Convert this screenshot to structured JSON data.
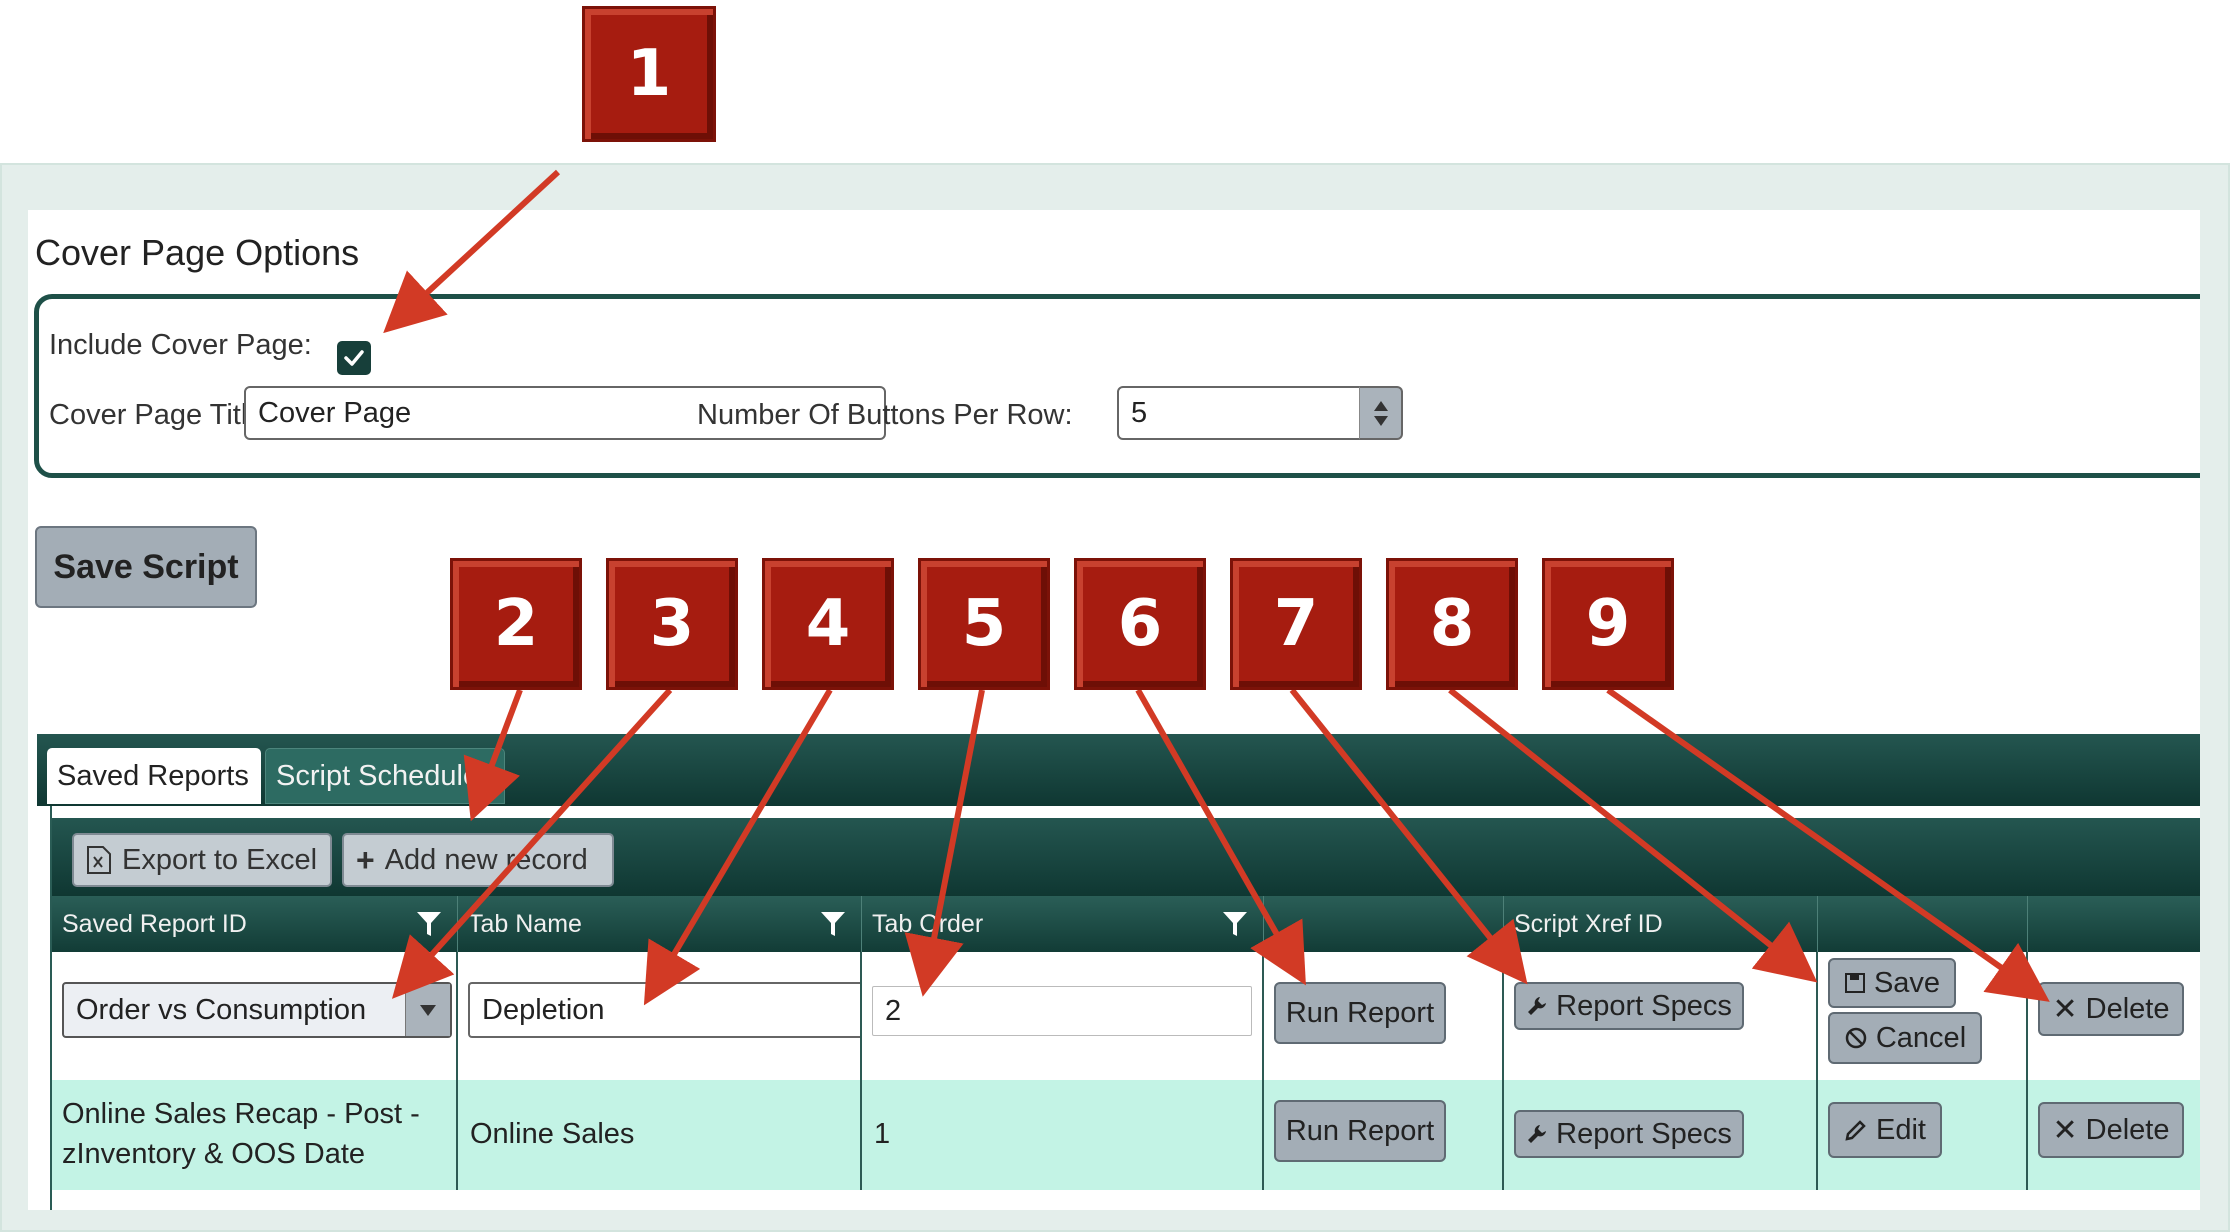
{
  "cover_page": {
    "title": "Cover Page Options",
    "include_label": "Include Cover Page:",
    "include_checked": true,
    "title_label": "Cover Page Title:",
    "title_value": "Cover Page",
    "buttons_per_row_label": "Number Of Buttons Per Row:",
    "buttons_per_row_value": "5"
  },
  "save_script_label": "Save Script",
  "tabs": [
    {
      "label": "Saved Reports",
      "active": true
    },
    {
      "label": "Script Schedule",
      "active": false
    }
  ],
  "toolbar": {
    "export_label": "Export to Excel",
    "add_label": "Add new record"
  },
  "columns": [
    "Saved Report ID",
    "Tab Name",
    "Tab Order",
    "",
    "Script Xref ID",
    "",
    ""
  ],
  "edit_row": {
    "report_id": "Order vs Consumption",
    "tab_name": "Depletion",
    "tab_order": "2",
    "run_label": "Run Report",
    "specs_label": "Report Specs",
    "save_label": "Save",
    "cancel_label": "Cancel",
    "delete_label": "Delete"
  },
  "view_row": {
    "report_id_line1": "Online Sales Recap - Post -",
    "report_id_line2": "zInventory & OOS Date",
    "tab_name": "Online Sales",
    "tab_order": "1",
    "run_label": "Run Report",
    "specs_label": "Report Specs",
    "edit_label": "Edit",
    "delete_label": "Delete"
  },
  "callouts": [
    "1",
    "2",
    "3",
    "4",
    "5",
    "6",
    "7",
    "8",
    "9"
  ],
  "colors": {
    "header_teal": "#1a4a44",
    "row_highlight": "#c3f3e5",
    "callout_red": "#a61c10",
    "arrow_red": "#d23a25"
  }
}
